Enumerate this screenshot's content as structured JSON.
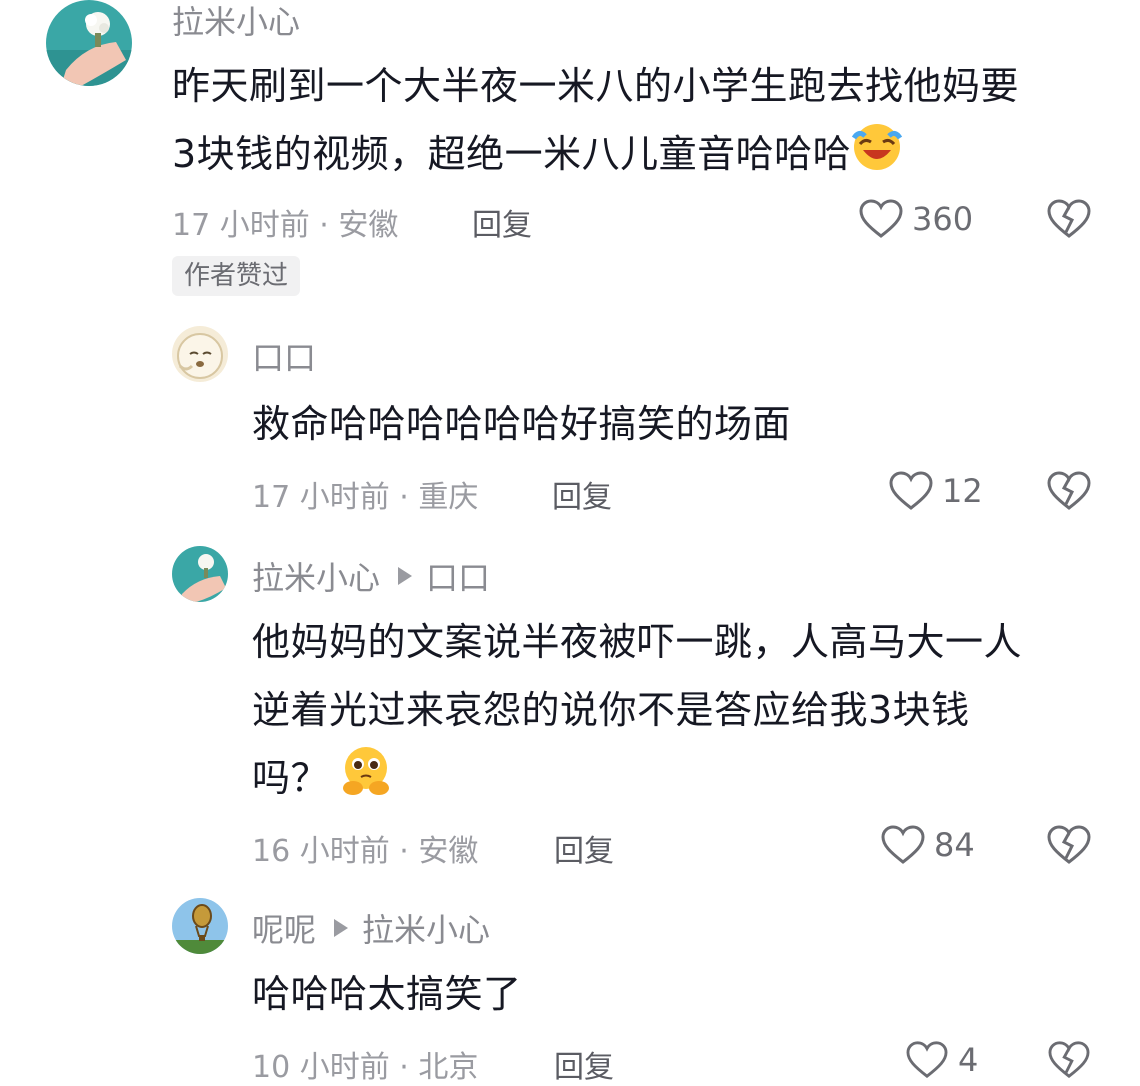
{
  "comments": [
    {
      "author": "拉米小心",
      "text_line1": "昨天刷到一个大半夜一米八的小学生跑去找他妈要",
      "text_line2": "3块钱的视频，超绝一米八儿童音哈哈哈",
      "emoji": "laughing-face-icon",
      "time_location": "17 小时前 · 安徽",
      "reply_label": "回复",
      "likes": "360",
      "badge": "作者赞过"
    },
    {
      "author": "口口",
      "text": "救命哈哈哈哈哈哈好搞笑的场面",
      "time_location": "17 小时前 · 重庆",
      "reply_label": "回复",
      "likes": "12"
    },
    {
      "author": "拉米小心",
      "reply_to": "口口",
      "text_line1": "他妈妈的文案说半夜被吓一跳，人高马大一人",
      "text_line2": "逆着光过来哀怨的说你不是答应给我3块钱",
      "text_line3": "吗？",
      "emoji": "pleading-face-icon",
      "time_location": "16 小时前 · 安徽",
      "reply_label": "回复",
      "likes": "84"
    },
    {
      "author": "呢呢",
      "reply_to": "拉米小心",
      "text": "哈哈哈太搞笑了",
      "time_location": "10 小时前 · 北京",
      "reply_label": "回复",
      "likes": "4"
    }
  ],
  "colors": {
    "text": "#161823",
    "meta": "#9a9ba1",
    "badge_bg": "#f1f1f2"
  }
}
